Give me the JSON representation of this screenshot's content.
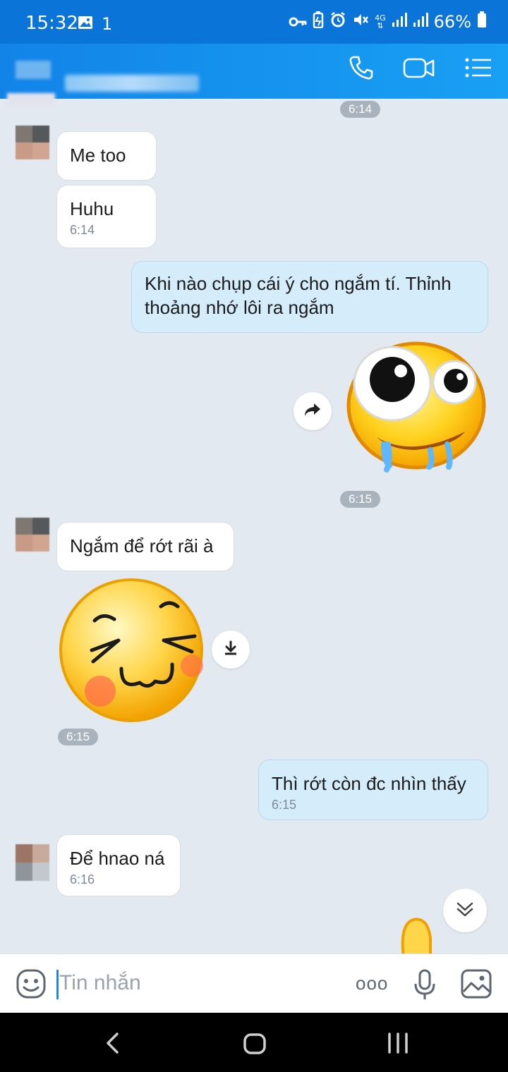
{
  "status_bar": {
    "time": "15:32",
    "left_icons": [
      "image-icon",
      "notification-1-icon"
    ],
    "right_icons": [
      "vpn-key-icon",
      "battery-saver-icon",
      "alarm-icon",
      "mute-icon",
      "4g-icon",
      "signal-icon",
      "signal-icon"
    ],
    "notification_count": "1",
    "network": "4G",
    "battery": "66%"
  },
  "header": {
    "actions": [
      "phone-icon",
      "video-call-icon",
      "menu-icon"
    ]
  },
  "messages": {
    "pill_1": "6:14",
    "m1": "Me too",
    "m2": {
      "text": "Huhu",
      "time": "6:14"
    },
    "m3": "Khi nào chụp cái ý cho ngắm tí. Thỉnh thoảng nhớ lôi ra ngắm",
    "pill_2": "6:15",
    "m4": "Ngắm để rớt rãi à",
    "pill_3": "6:15",
    "m5": {
      "text": "Thì rớt còn đc nhìn thấy",
      "time": "6:15"
    },
    "m6": {
      "text": "Để hnao ná",
      "time": "6:16"
    }
  },
  "input": {
    "placeholder": "Tin nhắn",
    "more": "ooo"
  },
  "colors": {
    "header": "#1284e8",
    "chat_bg": "#e2e9f1",
    "outgoing_bubble": "#d5ecfb",
    "incoming_bubble": "#ffffff"
  }
}
